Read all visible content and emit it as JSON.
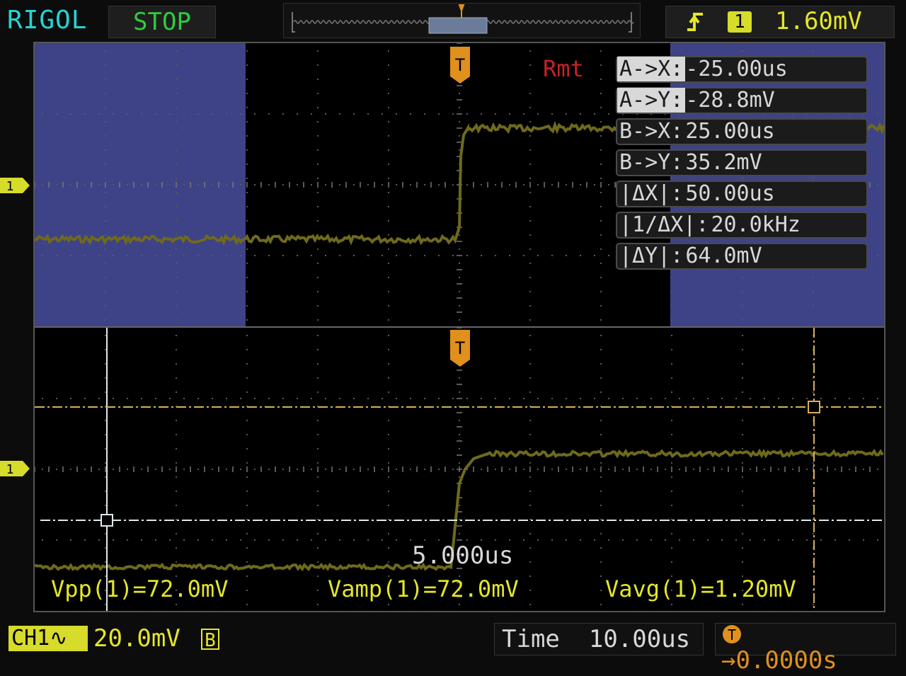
{
  "top_bar": {
    "brand": "RIGOL",
    "run_status": "STOP",
    "trigger": {
      "edge_icon": "rising-edge-icon",
      "source": "1",
      "level": "1.60mV"
    }
  },
  "main_window": {
    "remote_label": "Rmt",
    "trigger_marker": "T",
    "channel_marker": "1"
  },
  "cursor_panel": {
    "rows": [
      {
        "label": "A->X:",
        "value": "-25.00us",
        "highlighted": true
      },
      {
        "label": "A->Y:",
        "value": "-28.8mV",
        "highlighted": true
      },
      {
        "label": "B->X:",
        "value": "25.00us",
        "highlighted": false
      },
      {
        "label": "B->Y:",
        "value": "35.2mV",
        "highlighted": false
      },
      {
        "label": "|ΔX|:",
        "value": "50.00us",
        "highlighted": false
      },
      {
        "label": "|1/ΔX|:",
        "value": "20.0kHz",
        "highlighted": false
      },
      {
        "label": "|ΔY|:",
        "value": "64.0mV",
        "highlighted": false
      }
    ]
  },
  "zoom_window": {
    "trigger_marker": "T",
    "channel_marker": "1",
    "timebase": "5.000us",
    "measurements": [
      {
        "label": "Vpp(1)",
        "value": "72.0mV"
      },
      {
        "label": "Vamp(1)",
        "value": "72.0mV"
      },
      {
        "label": "Vavg(1)",
        "value": "1.20mV"
      }
    ]
  },
  "bottom_bar": {
    "channel": "CH1",
    "coupling_icon": "ac-coupling-icon",
    "scale": "20.0mV",
    "bandwidth_limit": "B",
    "time_label": "Time",
    "time_value": "10.00us",
    "trigger_offset": "0.0000s"
  },
  "colors": {
    "trace": "#6e6a1c",
    "cursor_a": "#dfe8ea",
    "cursor_b": "#d9ae5c",
    "channel_yellow": "#d7db2a",
    "trigger_orange": "#e0901c",
    "zoom_shade": "#3e4286",
    "remote_red": "#c62222"
  }
}
